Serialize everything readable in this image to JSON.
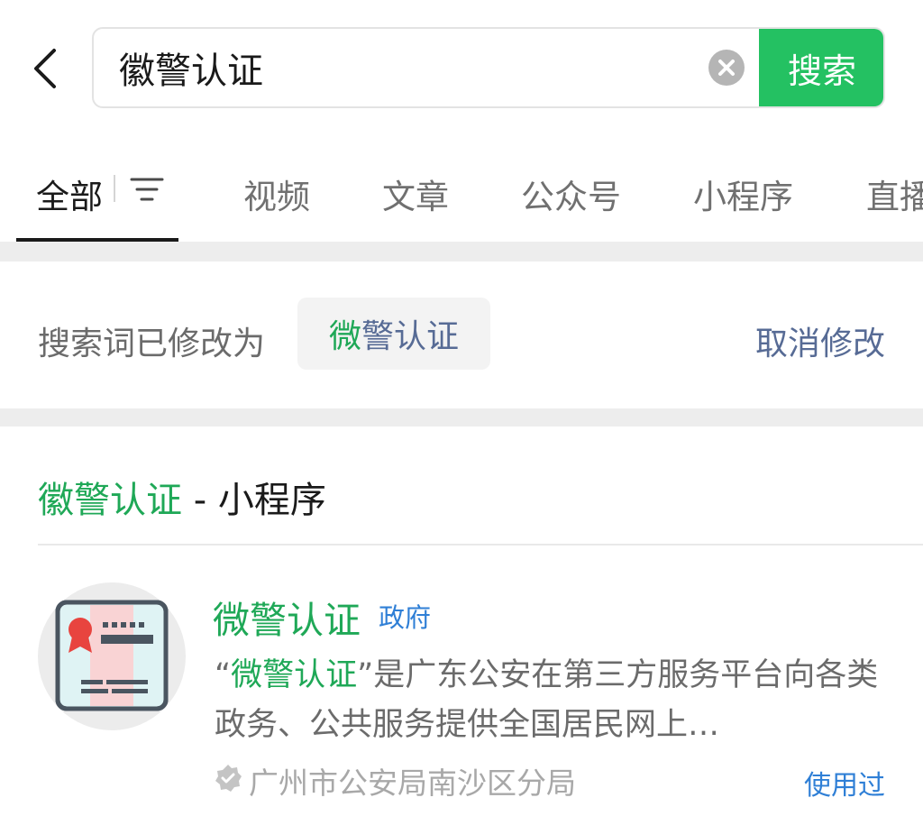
{
  "search": {
    "query": "徽警认证",
    "submit_label": "搜索"
  },
  "tabs": [
    {
      "label": "全部",
      "active": true
    },
    {
      "label": "视频",
      "active": false
    },
    {
      "label": "文章",
      "active": false
    },
    {
      "label": "公众号",
      "active": false
    },
    {
      "label": "小程序",
      "active": false
    },
    {
      "label": "直播",
      "active": false
    }
  ],
  "correction": {
    "prefix": "搜索词已修改为",
    "corrected_first": "微",
    "corrected_rest": "警认证",
    "cancel_label": "取消修改"
  },
  "section": {
    "title_highlight": "徽警认证",
    "title_rest": " - 小程序"
  },
  "result": {
    "name": "微警认证",
    "tag": "政府",
    "desc_open_quote": "“",
    "desc_highlight": "微警认证",
    "desc_rest": "”是广东公安在第三方服务平台向各类政务、公共服务提供全国居民网上…",
    "owner": "广州市公安局南沙区分局",
    "used_label": "使用过"
  },
  "colors": {
    "accent_green": "#24c162",
    "highlight_green": "#1fa857",
    "link_blue": "#576b95",
    "tag_blue": "#2f7fd6",
    "divider_gray": "#ededed"
  }
}
